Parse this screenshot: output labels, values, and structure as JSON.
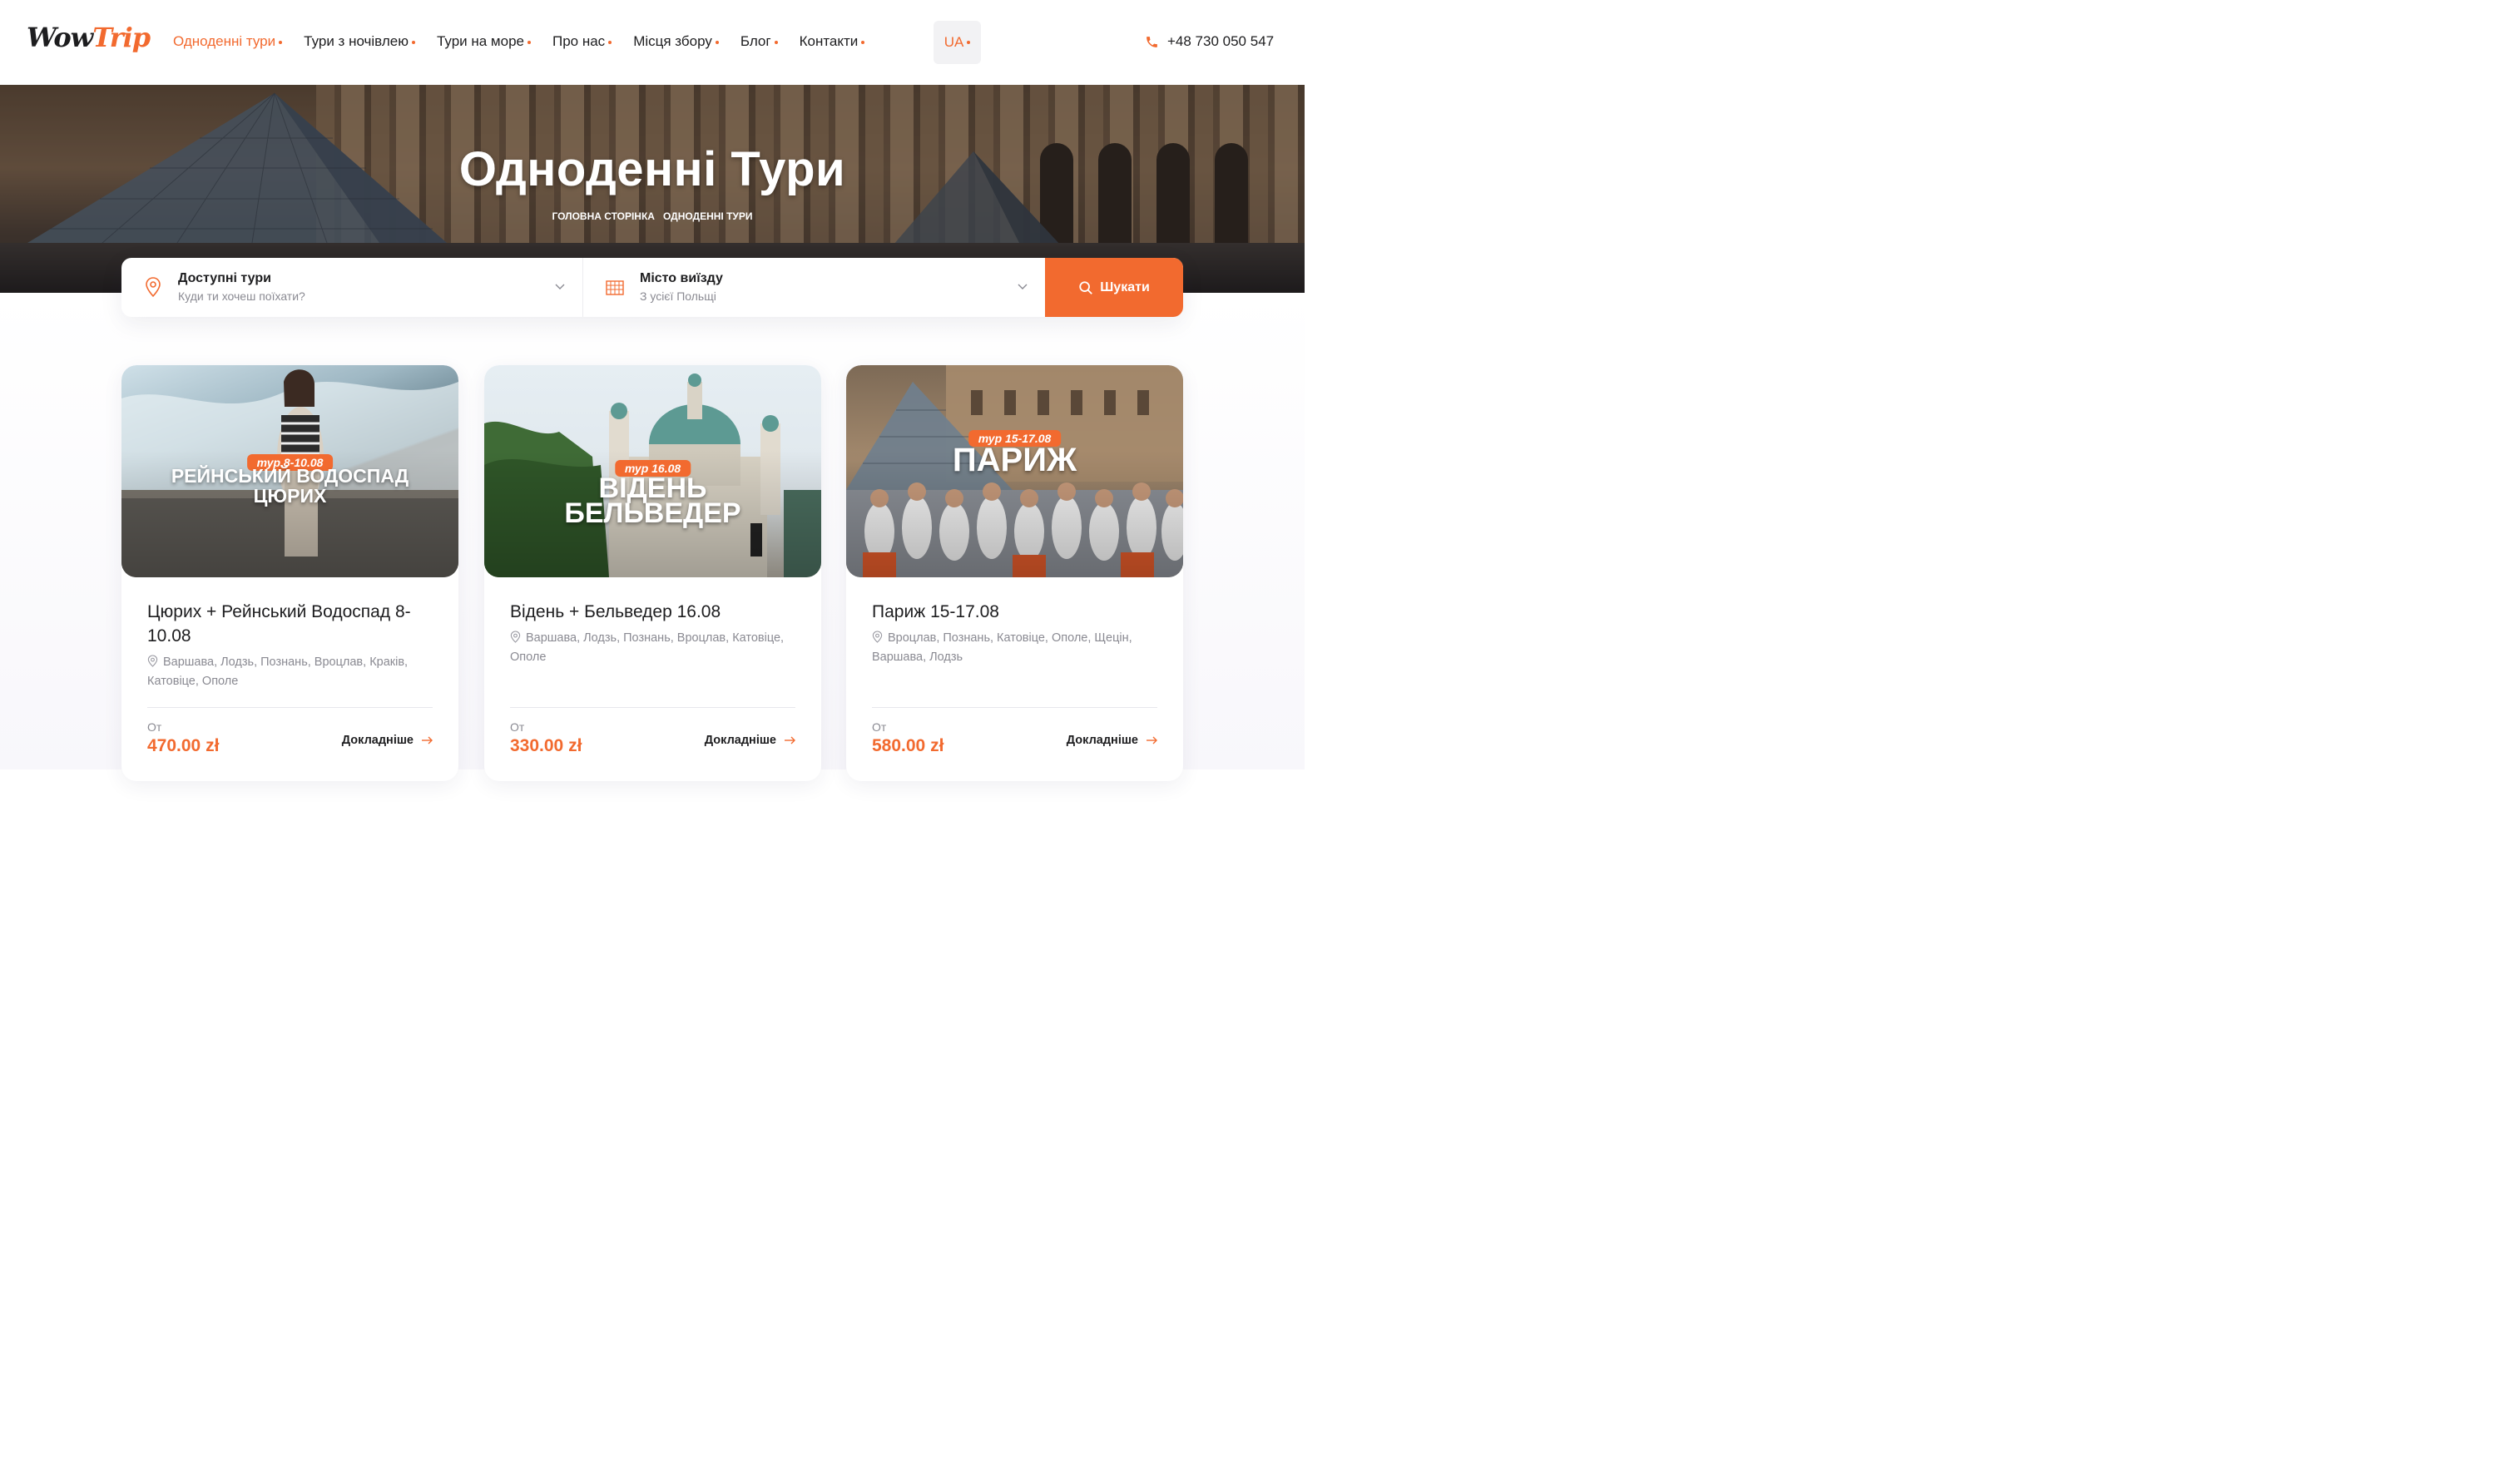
{
  "header": {
    "logo_wow": "Wow",
    "logo_trip": "Trip",
    "nav": [
      {
        "label": "Одноденні тури",
        "active": true
      },
      {
        "label": "Тури з ночівлею",
        "active": false
      },
      {
        "label": "Тури на море",
        "active": false
      },
      {
        "label": "Про нас",
        "active": false
      },
      {
        "label": "Місця збору",
        "active": false
      },
      {
        "label": "Блог",
        "active": false
      },
      {
        "label": "Контакти",
        "active": false
      }
    ],
    "lang": "UA",
    "phone": "+48 730 050 547"
  },
  "hero": {
    "title": "Одноденні Тури",
    "breadcrumb_home": "Головна сторінка",
    "breadcrumb_current": "Одноденні тури"
  },
  "search": {
    "tours_label": "Доступні тури",
    "tours_placeholder": "Куди ти хочеш поїхати?",
    "city_label": "Місто виїзду",
    "city_placeholder": "З усієї Польщі",
    "button": "Шукати"
  },
  "cards": [
    {
      "badge": "тур 8-10.08",
      "poster_line1": "РЕЙНСЬКИЙ ВОДОСПАД",
      "poster_line2": "ЦЮРИХ",
      "title": "Цюрих + Рейнський Водоспад 8-10.08",
      "cities": "Варшава, Лодзь, Познань, Вроцлав, Краків, Катовіце, Ополе",
      "from": "От",
      "price": "470.00 zł",
      "more": "Докладніше"
    },
    {
      "badge": "тур 16.08",
      "poster_line1": "ВІДЕНЬ",
      "poster_line2": "БЕЛЬВЕДЕР",
      "title": "Відень + Бельведер 16.08",
      "cities": "Варшава, Лодзь, Познань, Вроцлав, Катовіце, Ополе",
      "from": "От",
      "price": "330.00 zł",
      "more": "Докладніше"
    },
    {
      "badge": "тур 15-17.08",
      "poster_line1": "ПАРИЖ",
      "poster_line2": "",
      "title": "Париж 15-17.08",
      "cities": "Вроцлав, Познань, Катовіце, Ополе, Щецін, Варшава, Лодзь",
      "from": "От",
      "price": "580.00 zł",
      "more": "Докладніше"
    }
  ],
  "colors": {
    "accent": "#f26a2f",
    "text": "#1d1d1f",
    "muted": "#8a8a92"
  }
}
